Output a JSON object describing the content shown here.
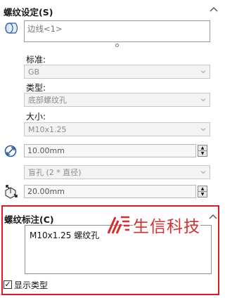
{
  "thread_settings": {
    "title": "螺纹设定(S)",
    "edge_placeholder": "边线<1>",
    "standard_label": "标准:",
    "standard_value": "GB",
    "type_label": "类型:",
    "type_value": "底部螺纹孔",
    "size_label": "大小:",
    "size_value": "M10x1.25",
    "diameter_value": "10.00mm",
    "end_condition_value": "盲孔 (2 * 直径)",
    "depth_value": "20.00mm"
  },
  "thread_callout": {
    "title": "螺纹标注(C)",
    "callout_text": "M10x1.25 螺纹孔",
    "show_type_label": "显示类型",
    "show_type_checked": true
  },
  "watermark": {
    "text": "生信科技"
  },
  "colors": {
    "highlight_border": "#e5171f",
    "watermark": "#d32f2f",
    "disabled_text": "#8c8c8c"
  }
}
